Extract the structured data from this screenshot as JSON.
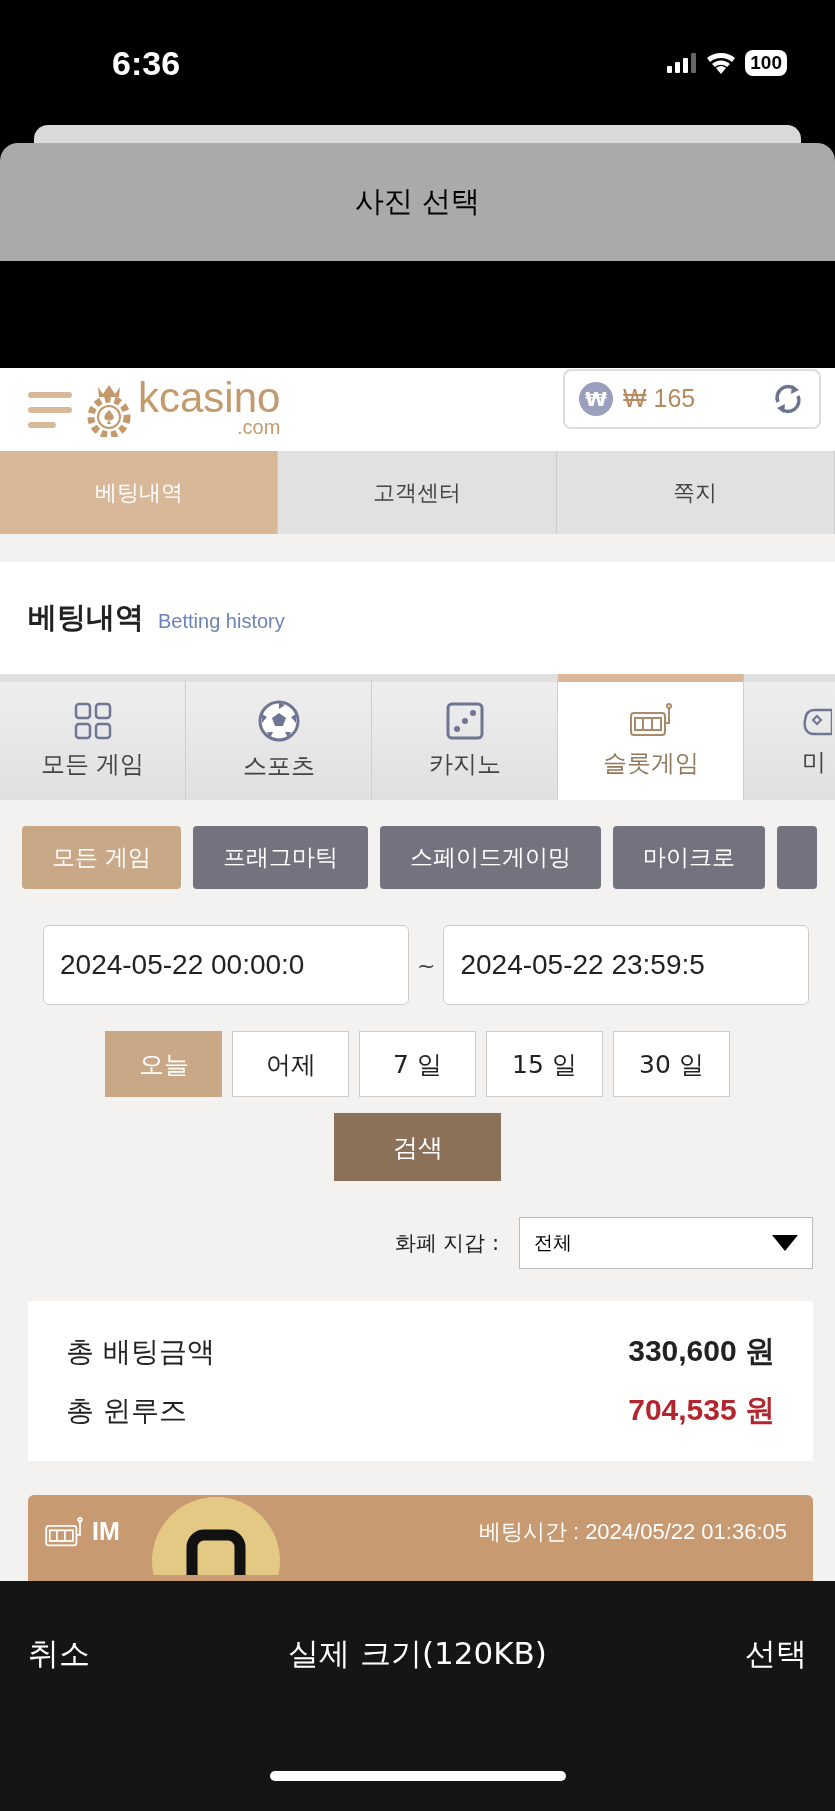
{
  "status_bar": {
    "time": "6:36",
    "battery": "100"
  },
  "sheet": {
    "title": "사진 선택"
  },
  "site": {
    "logo": "kcasino",
    "logo_sub": ".com",
    "balance": "₩ 165",
    "balance_symbol": "₩"
  },
  "nav_tabs": [
    {
      "label": "베팅내역",
      "selected": true
    },
    {
      "label": "고객센터",
      "selected": false
    },
    {
      "label": "쪽지",
      "selected": false
    }
  ],
  "section": {
    "title": "베팅내역",
    "subtitle": "Betting history"
  },
  "categories": [
    {
      "label": "모든 게임",
      "kind": "grid",
      "selected": false
    },
    {
      "label": "스포츠",
      "kind": "ball",
      "selected": false
    },
    {
      "label": "카지노",
      "kind": "dice",
      "selected": false
    },
    {
      "label": "슬롯게임",
      "kind": "slot",
      "selected": true
    },
    {
      "label": "미",
      "kind": "gamepad",
      "selected": false
    }
  ],
  "providers": [
    {
      "label": "모든 게임",
      "selected": true
    },
    {
      "label": "프래그마틱",
      "selected": false
    },
    {
      "label": "스페이드게이밍",
      "selected": false
    },
    {
      "label": "마이크로",
      "selected": false
    }
  ],
  "date_range": {
    "from": "2024-05-22 00:00:0",
    "separator": "~",
    "to": "2024-05-22 23:59:5"
  },
  "quick_dates": [
    {
      "label": "오늘",
      "selected": true
    },
    {
      "label": "어제",
      "selected": false
    },
    {
      "label": "7 일",
      "selected": false
    },
    {
      "label": "15 일",
      "selected": false
    },
    {
      "label": "30 일",
      "selected": false
    }
  ],
  "search_button": "검색",
  "wallet": {
    "label": "화폐 지갑 :",
    "value": "전체"
  },
  "summary": [
    {
      "label": "총 배팅금액",
      "value": "330,600 원",
      "kind": "normal"
    },
    {
      "label": "총 윈루즈",
      "value": "704,535 원",
      "kind": "negative"
    }
  ],
  "bet_card": {
    "provider": "IM",
    "time": "베팅시간 : 2024/05/22 01:36:05"
  },
  "footer": {
    "cancel": "취소",
    "size": "실제 크기(120KB)",
    "select": "선택"
  }
}
